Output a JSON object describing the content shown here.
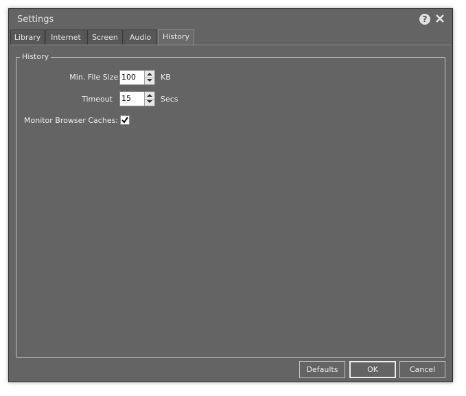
{
  "window": {
    "title": "Settings"
  },
  "tabs": [
    {
      "label": "Library",
      "active": false
    },
    {
      "label": "Internet",
      "active": false
    },
    {
      "label": "Screen",
      "active": false
    },
    {
      "label": "Audio",
      "active": false
    },
    {
      "label": "History",
      "active": true
    }
  ],
  "history": {
    "group_title": "History",
    "min_file_size": {
      "label": "Min. File Size:",
      "value": "100",
      "unit": "KB"
    },
    "timeout": {
      "label": "Timeout",
      "value": "15",
      "unit": "Secs"
    },
    "monitor_browser_caches": {
      "label": "Monitor Browser Caches:",
      "checked": true
    }
  },
  "buttons": {
    "defaults": "Defaults",
    "ok": "OK",
    "cancel": "Cancel"
  },
  "icons": {
    "help": "help-icon",
    "close": "close-icon",
    "check": "checkmark-icon"
  }
}
